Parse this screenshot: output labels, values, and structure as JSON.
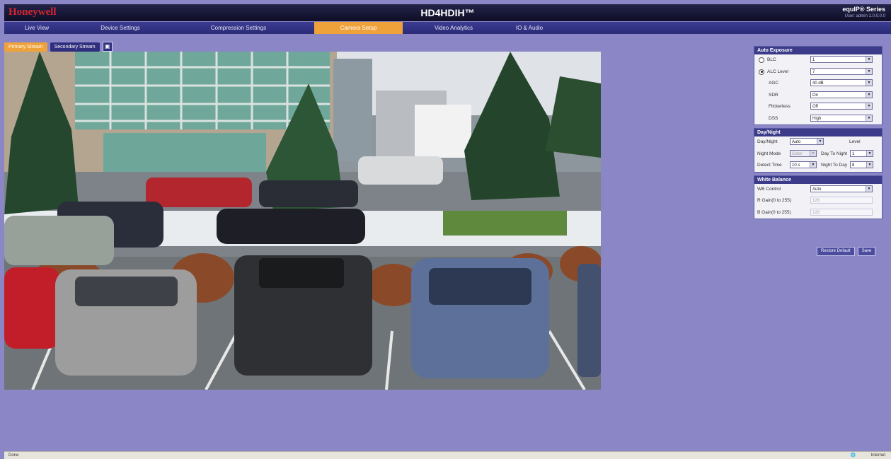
{
  "header": {
    "brand": "Honeywell",
    "product": "HD4HDIH™",
    "series": "equIP® Series",
    "user_line": "User: admin 1.0.0.0.0"
  },
  "nav": {
    "tabs": [
      "Live View",
      "Device Settings",
      "Compression Settings",
      "Camera Setup",
      "Video Analytics",
      "IO & Audio"
    ],
    "active": "Camera Setup"
  },
  "streams": {
    "tabs": [
      "Primary Stream",
      "Secondary Stream"
    ],
    "active": "Primary Stream"
  },
  "panel": {
    "auto_exposure": {
      "title": "Auto Exposure",
      "blc_label": "BLC",
      "blc_value": "1",
      "alc_label": "ALC Level",
      "alc_value": "7",
      "agc_label": "AGC",
      "agc_value": "40 dB",
      "sdr_label": "SDR",
      "sdr_value": "On",
      "flickerless_label": "Flickerless",
      "flickerless_value": "Off",
      "dss_label": "DSS",
      "dss_value": "High",
      "selected_mode": "ALC Level"
    },
    "day_night": {
      "title": "Day/Night",
      "mode_label": "Day/Night",
      "mode_value": "Auto",
      "level_label": "Level",
      "night_mode_label": "Night Mode",
      "night_mode_value": "Color",
      "day_to_night_label": "Day To Night",
      "day_to_night_value": "1",
      "detect_time_label": "Detect Time",
      "detect_time_value": "10 s",
      "night_to_day_label": "Night To Day",
      "night_to_day_value": "8"
    },
    "white_balance": {
      "title": "White Balance",
      "wb_control_label": "WB Control",
      "wb_control_value": "Auto",
      "r_gain_label": "R Gain(0 to 255)",
      "r_gain_value": "128",
      "b_gain_label": "B Gain(0 to 255)",
      "b_gain_value": "128"
    },
    "buttons": {
      "default": "Restore Default",
      "save": "Save"
    }
  },
  "status": {
    "left": "Done",
    "right": "Internet"
  },
  "colors": {
    "background": "#8b87c6",
    "nav": "#2b2b78",
    "accent": "#f0a23a",
    "brand": "#d3262f"
  }
}
